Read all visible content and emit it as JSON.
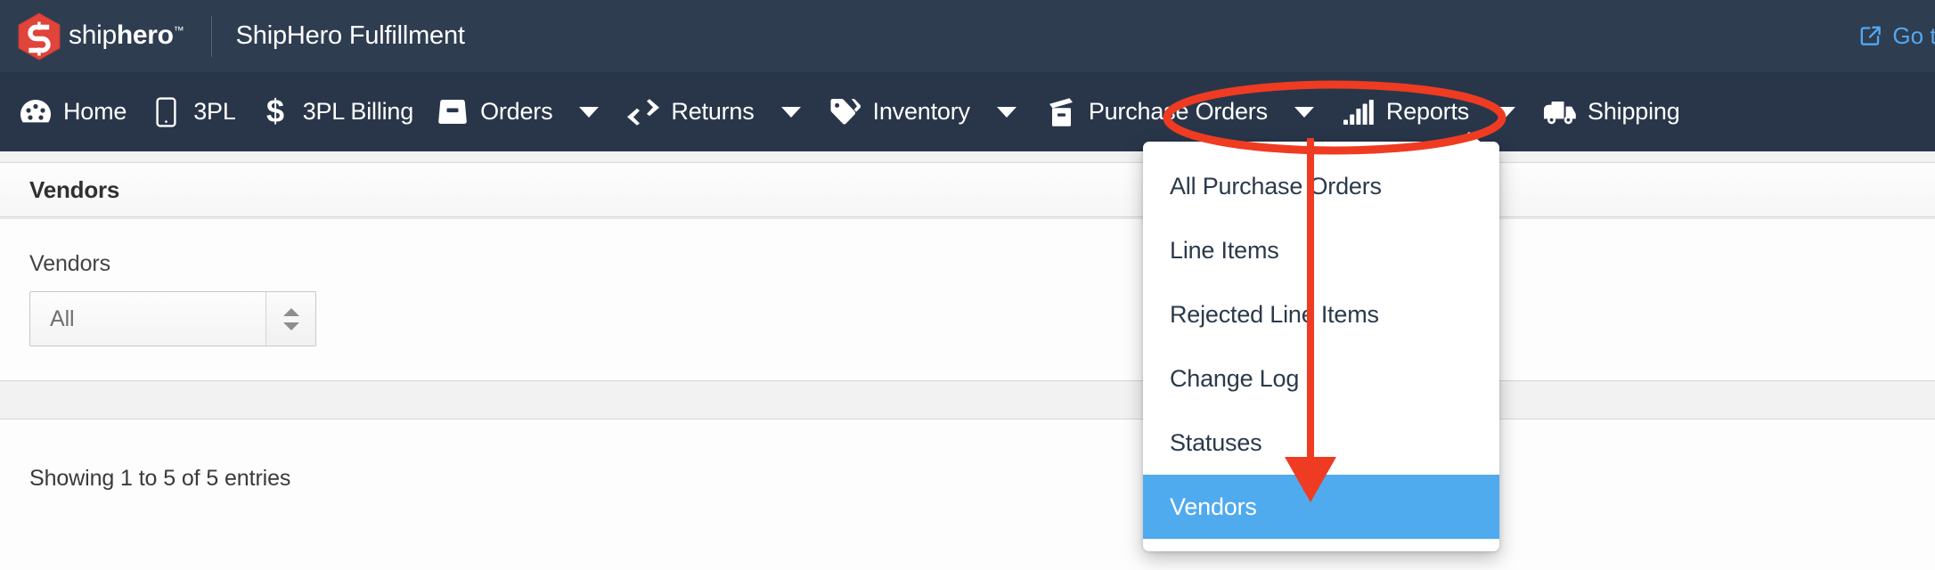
{
  "brand": {
    "logo_text_light": "ship",
    "logo_text_bold": "hero",
    "logo_tm": "™",
    "app_title": "ShipHero Fulfillment",
    "logo_color": "#e0443a"
  },
  "topbar": {
    "goto_label": "Go to",
    "goto_icon": "external-link-icon",
    "link_color": "#52a8f0",
    "background": "#2f3d51"
  },
  "nav": {
    "background": "#29364a",
    "items": [
      {
        "label": "Home",
        "icon": "dashboard-gauge-icon",
        "caret": false
      },
      {
        "label": "3PL",
        "icon": "mobile-device-icon",
        "caret": false
      },
      {
        "label": "3PL Billing",
        "icon": "dollar-sign-icon",
        "caret": false
      },
      {
        "label": "Orders",
        "icon": "inbox-tray-icon",
        "caret": true
      },
      {
        "label": "Returns",
        "icon": "exchange-arrows-icon",
        "caret": true
      },
      {
        "label": "Inventory",
        "icon": "price-tag-icon",
        "caret": true
      },
      {
        "label": "Purchase Orders",
        "icon": "box-archive-icon",
        "caret": true
      },
      {
        "label": "Reports",
        "icon": "bar-chart-icon",
        "caret": true
      },
      {
        "label": "Shipping",
        "icon": "delivery-truck-icon",
        "caret": false
      }
    ]
  },
  "dropdown": {
    "parent": "Purchase Orders",
    "highlight_color": "#4faaee",
    "items": [
      {
        "label": "All Purchase Orders",
        "active": false
      },
      {
        "label": "Line Items",
        "active": false
      },
      {
        "label": "Rejected Line Items",
        "active": false
      },
      {
        "label": "Change Log",
        "active": false
      },
      {
        "label": "Statuses",
        "active": false
      },
      {
        "label": "Vendors",
        "active": true
      }
    ]
  },
  "page": {
    "panel_title": "Vendors",
    "filter_label": "Vendors",
    "filter_value": "All",
    "entries_text": "Showing 1 to 5 of 5 entries"
  },
  "annotation": {
    "color": "#ef3b22",
    "ellipse_target": "Purchase Orders",
    "arrow_target": "Vendors"
  }
}
